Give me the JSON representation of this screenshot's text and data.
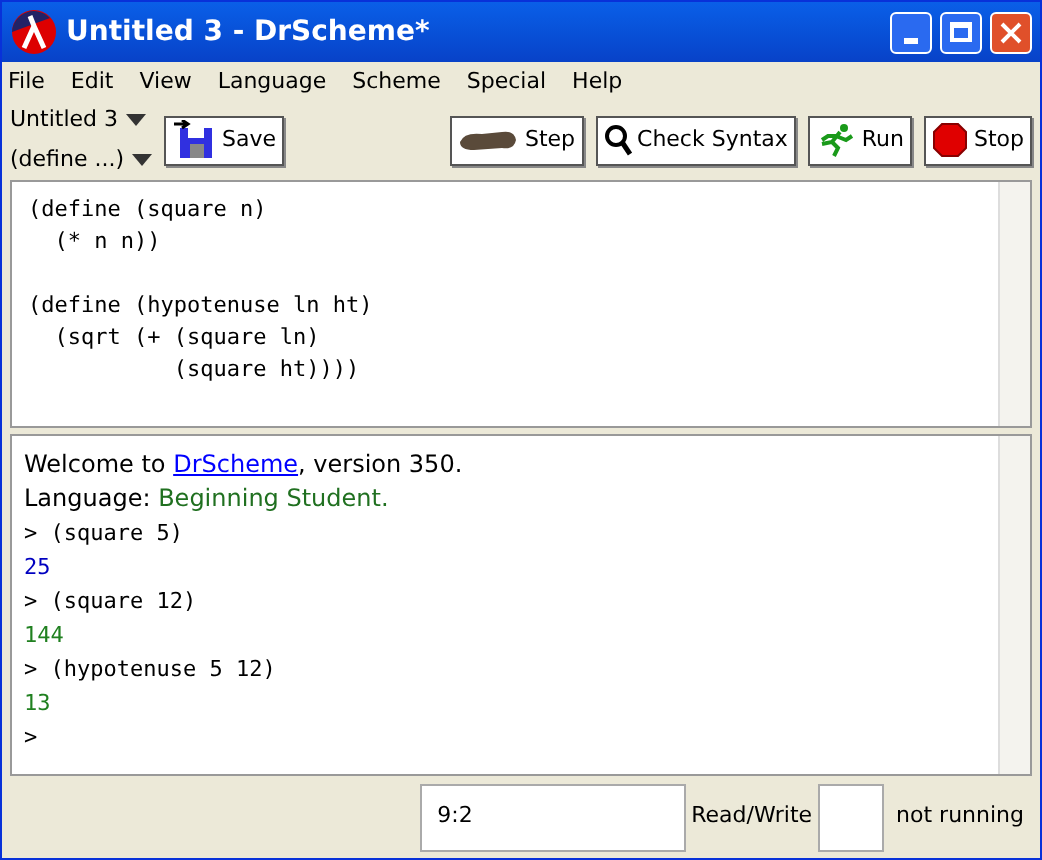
{
  "window": {
    "title": "Untitled 3 - DrScheme*"
  },
  "menu": [
    "File",
    "Edit",
    "View",
    "Language",
    "Scheme",
    "Special",
    "Help"
  ],
  "toolbar": {
    "file_popup": "Untitled 3",
    "define_popup": "(define ...)",
    "buttons": [
      {
        "kind": "save",
        "label": "Save"
      },
      {
        "kind": "step",
        "label": "Step"
      },
      {
        "kind": "check",
        "label": "Check Syntax"
      },
      {
        "kind": "run",
        "label": "Run"
      },
      {
        "kind": "stop",
        "label": "Stop"
      }
    ]
  },
  "definitions": [
    {
      "lines": [
        "(define (square n)",
        "  (* n n))"
      ]
    },
    {
      "lines": [
        "(define (hypotenuse ln ht)",
        "  (sqrt (+ (square ln)",
        "           (square ht))))"
      ]
    }
  ],
  "interactions": [
    {
      "kind": "welcome",
      "before": "Welcome to ",
      "link": "DrScheme",
      "after": ", version 350."
    },
    {
      "kind": "language",
      "label": "Language: ",
      "value": "Beginning Student."
    },
    {
      "kind": "input",
      "text": "> (square 5)"
    },
    {
      "kind": "value",
      "text": "25",
      "color": "#0000c0"
    },
    {
      "kind": "input",
      "text": "> (square 12)"
    },
    {
      "kind": "value",
      "text": "144",
      "color": "#208020"
    },
    {
      "kind": "input",
      "text": "> (hypotenuse 5 12)"
    },
    {
      "kind": "value",
      "text": "13",
      "color": "#208020"
    },
    {
      "kind": "input",
      "text": ">"
    }
  ],
  "status_bar": {
    "position": "9:2",
    "mode": "Read/Write",
    "state": "not running"
  }
}
